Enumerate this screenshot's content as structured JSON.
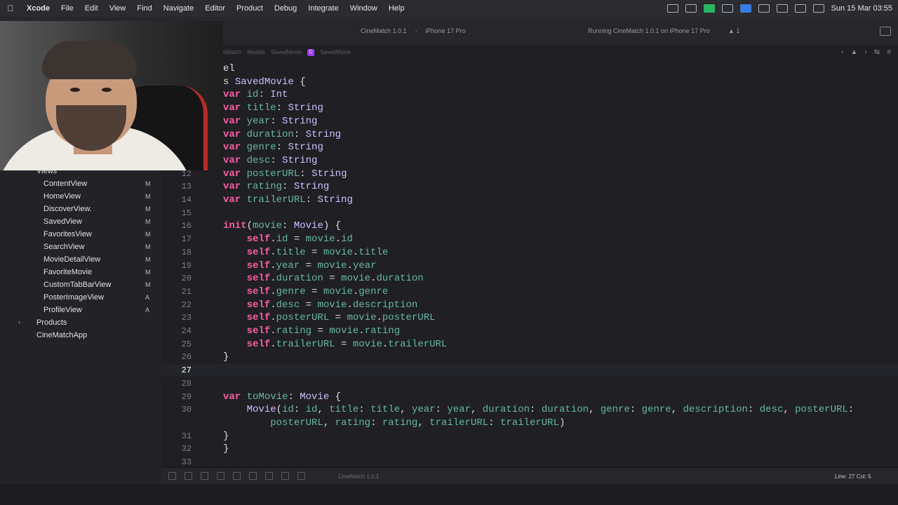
{
  "menubar": {
    "app": "Xcode",
    "items": [
      "File",
      "Edit",
      "View",
      "Find",
      "Navigate",
      "Editor",
      "Product",
      "Debug",
      "Integrate",
      "Window",
      "Help"
    ],
    "clock": "Sun 15 Mar 03:55"
  },
  "toolbar": {
    "scheme": "CineMatch 1.0.1",
    "device": "iPhone 17 Pro",
    "status": "Running CineMatch 1.0.1 on iPhone 17 Pro",
    "warnings": "▲ 1"
  },
  "jumpbar": {
    "crumbs": [
      "eMatch",
      "Models",
      "SavedMovie",
      "SavedMovie"
    ],
    "class_badge": "C"
  },
  "navigator": {
    "group": "Views",
    "files": [
      {
        "name": "ContentView",
        "status": "M"
      },
      {
        "name": "HomeView",
        "status": "M"
      },
      {
        "name": "DiscoverView.",
        "status": "M"
      },
      {
        "name": "SavedView",
        "status": "M"
      },
      {
        "name": "FavoritesView",
        "status": "M"
      },
      {
        "name": "SearchView",
        "status": "M"
      },
      {
        "name": "MovieDetailView",
        "status": "M"
      },
      {
        "name": "FavoriteMovie",
        "status": "M"
      },
      {
        "name": "CustomTabBarView",
        "status": "M"
      },
      {
        "name": "PosterImageView",
        "status": "A"
      },
      {
        "name": "ProfileView",
        "status": "A"
      }
    ],
    "products": "Products",
    "products_disclosure": "›",
    "app_entry": "CineMatchApp"
  },
  "editor": {
    "current_line": "27",
    "lines": [
      {
        "n": "",
        "t": "el"
      },
      {
        "n": "",
        "t": "s SavedMovie {"
      },
      {
        "n": "",
        "t": "var id: Int"
      },
      {
        "n": "",
        "t": "var title: String"
      },
      {
        "n": "",
        "t": "var year: String"
      },
      {
        "n": "",
        "t": "var duration: String"
      },
      {
        "n": "",
        "t": "var genre: String"
      },
      {
        "n": "",
        "t": "var desc: String"
      },
      {
        "n": "12",
        "t": "var posterURL: String"
      },
      {
        "n": "13",
        "t": "var rating: String"
      },
      {
        "n": "14",
        "t": "var trailerURL: String"
      },
      {
        "n": "15",
        "t": ""
      },
      {
        "n": "16",
        "t": "init(movie: Movie) {"
      },
      {
        "n": "17",
        "t": "    self.id = movie.id"
      },
      {
        "n": "18",
        "t": "    self.title = movie.title"
      },
      {
        "n": "19",
        "t": "    self.year = movie.year"
      },
      {
        "n": "20",
        "t": "    self.duration = movie.duration"
      },
      {
        "n": "21",
        "t": "    self.genre = movie.genre"
      },
      {
        "n": "22",
        "t": "    self.desc = movie.description"
      },
      {
        "n": "23",
        "t": "    self.posterURL = movie.posterURL"
      },
      {
        "n": "24",
        "t": "    self.rating = movie.rating"
      },
      {
        "n": "25",
        "t": "    self.trailerURL = movie.trailerURL"
      },
      {
        "n": "26",
        "t": "}"
      },
      {
        "n": "27",
        "t": ""
      },
      {
        "n": "28",
        "t": ""
      },
      {
        "n": "29",
        "t": "var toMovie: Movie {"
      },
      {
        "n": "30",
        "t": "    Movie(id: id, title: title, year: year, duration: duration, genre: genre, description: desc, posterURL:"
      },
      {
        "n": "",
        "t": "        posterURL, rating: rating, trailerURL: trailerURL)"
      },
      {
        "n": "31",
        "t": "}"
      },
      {
        "n": "32",
        "t": "}"
      },
      {
        "n": "33",
        "t": ""
      }
    ]
  },
  "debugbar": {
    "target": "CineMatch 1.0.1",
    "position": "Line: 27  Col: 5"
  },
  "colors": {
    "keyword": "#fc5fa3",
    "type": "#d0bfff",
    "property": "#67b7a4",
    "accent": "#2f7cf6"
  }
}
